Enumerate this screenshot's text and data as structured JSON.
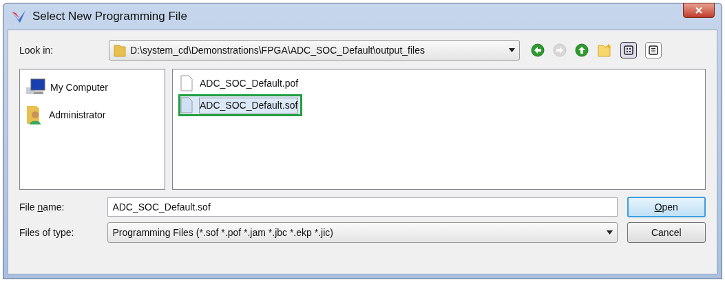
{
  "window": {
    "title": "Select New Programming File"
  },
  "look_in": {
    "label": "Look in:",
    "value": "D:\\system_cd\\Demonstrations\\FPGA\\ADC_SOC_Default\\output_files"
  },
  "toolbar": [
    {
      "kind": "back",
      "disabled": false
    },
    {
      "kind": "forward",
      "disabled": true
    },
    {
      "kind": "up",
      "disabled": false
    },
    {
      "kind": "new-folder"
    },
    {
      "kind": "list-view",
      "selected": true
    },
    {
      "kind": "detail-view",
      "selected": false
    }
  ],
  "places": [
    {
      "kind": "computer",
      "label": "My Computer"
    },
    {
      "kind": "user",
      "label": "Administrator"
    }
  ],
  "files": [
    {
      "name": "ADC_SOC_Default.pof",
      "selected": false,
      "highlighted": false
    },
    {
      "name": "ADC_SOC_Default.sof",
      "selected": true,
      "highlighted": true
    }
  ],
  "file_name": {
    "label": {
      "before": "File ",
      "key": "n",
      "after": "ame:"
    },
    "value": "ADC_SOC_Default.sof"
  },
  "file_type": {
    "label": "Files of type:",
    "value": "Programming Files (*.sof *.pof *.jam *.jbc *.ekp *.jic)"
  },
  "buttons": [
    {
      "label": {
        "key": "O",
        "after": "pen"
      },
      "default": true
    },
    {
      "label": {
        "before": "Cancel"
      },
      "default": false
    }
  ]
}
